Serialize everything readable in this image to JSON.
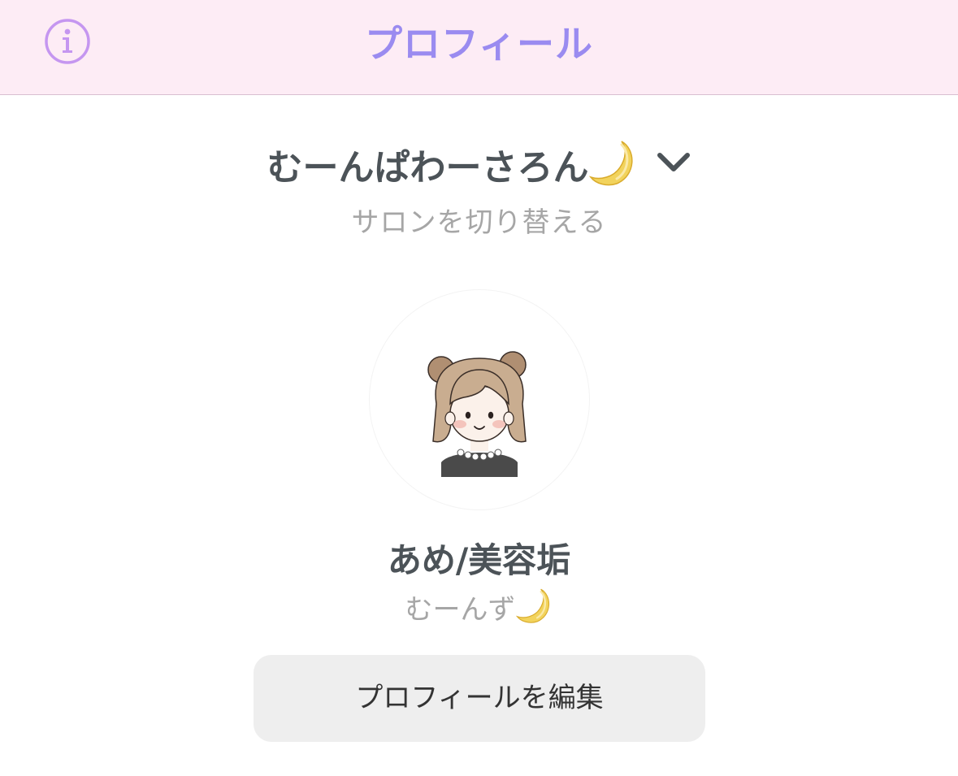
{
  "header": {
    "title": "プロフィール",
    "info_icon": "info-icon",
    "background_color": "#fdecf5",
    "title_color": "#9a8bf0"
  },
  "salon": {
    "name": "むーんぱわーさろん",
    "name_emoji_icon": "crescent-moon-icon",
    "dropdown_icon": "chevron-down-icon",
    "switch_label": "サロンを切り替える"
  },
  "profile": {
    "avatar_icon": "girl-illustration-avatar",
    "name": "あめ/美容垢",
    "subtitle": "むーんず",
    "subtitle_emoji_icon": "crescent-moon-icon"
  },
  "actions": {
    "edit_profile_label": "プロフィールを編集"
  }
}
